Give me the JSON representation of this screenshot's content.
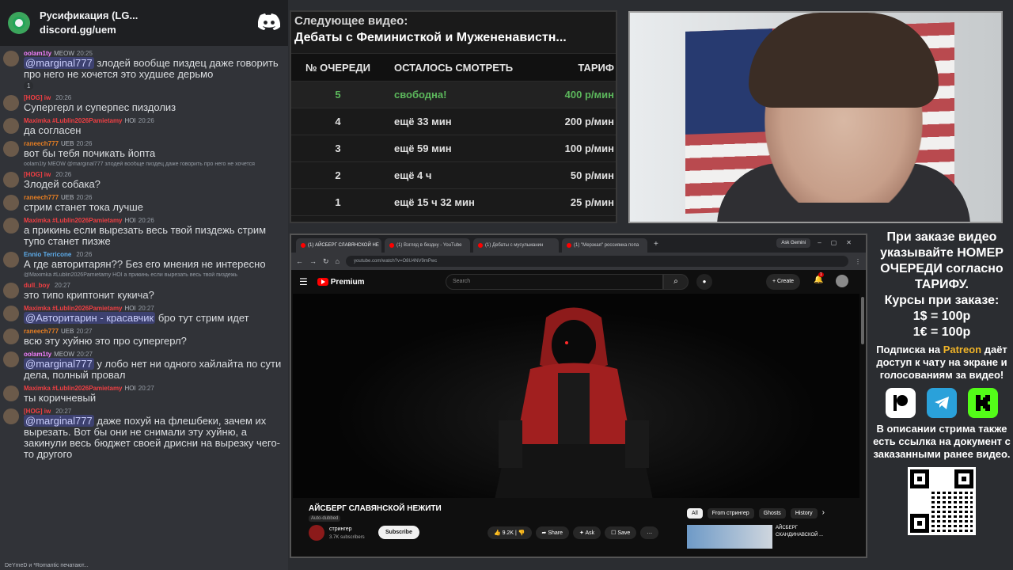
{
  "discord": {
    "server_name": "Русификация (LG...",
    "server_link": "discord.gg/uem",
    "typing_text": "DeYmeD и *Romantic печатают..."
  },
  "messages": [
    {
      "name": "oolam1ty",
      "name_color": "#f47fff",
      "tag": "MEOW",
      "time": "20:25",
      "mention": "@marginal777",
      "text": " злодей вообще пиздец даже говорить про него не хочется это худшее дерьмо",
      "reactions": [
        "1"
      ]
    },
    {
      "name": "[HOG] iw",
      "name_color": "#f23f43",
      "tag": "",
      "time": "20:26",
      "mention": "",
      "text": "Супергерл и суперпес пиздолиз"
    },
    {
      "name": "Maximka #Lublin2026Pamietamy",
      "name_color": "#f23f43",
      "tag": "HOI",
      "time": "20:26",
      "mention": "",
      "text": "да согласен"
    },
    {
      "name": "raneech777",
      "name_color": "#e67e22",
      "tag": "UEB",
      "time": "20:26",
      "mention": "",
      "text": "вот бы тебя почикать йопта"
    },
    {
      "reply": "oolam1ty MEOW @marginal777 злодей вообще пиздец даже говорить про него не хочется",
      "name": "[HOG] iw",
      "name_color": "#f23f43",
      "tag": "",
      "time": "20:26",
      "mention": "",
      "text": "Злодей собака?"
    },
    {
      "name": "raneech777",
      "name_color": "#e67e22",
      "tag": "UEB",
      "time": "20:26",
      "mention": "",
      "text": "стрим станет тока лучше"
    },
    {
      "name": "Maximka #Lublin2026Pamietamy",
      "name_color": "#f23f43",
      "tag": "HOI",
      "time": "20:26",
      "mention": "",
      "text": "а прикинь если вырезать весь твой пиздежь стрим тупо станет пизже"
    },
    {
      "name": "Ennio Terricone",
      "name_color": "#5dadec",
      "tag": "",
      "time": "20:26",
      "mention": "",
      "text": "А где авторитарян?? Без его мнения не интересно"
    },
    {
      "reply": "@Maximka #Lublin2026Pamietamy HOI а прикинь если вырезать весь твой пиздежь",
      "name": "dull_boy",
      "name_color": "#f23f43",
      "tag": "",
      "time": "20:27",
      "mention": "",
      "text": "это типо криптонит кукича?"
    },
    {
      "name": "Maximka #Lublin2026Pamietamy",
      "name_color": "#f23f43",
      "tag": "HOI",
      "time": "20:27",
      "mention": "@Авторитарин - красавчик",
      "text": " бро тут стрим идет"
    },
    {
      "name": "raneech777",
      "name_color": "#e67e22",
      "tag": "UEB",
      "time": "20:27",
      "mention": "",
      "text": "всю эту хуйню это про супергерл?"
    },
    {
      "name": "oolam1ty",
      "name_color": "#f47fff",
      "tag": "MEOW",
      "time": "20:27",
      "mention": "@marginal777",
      "text": " у лобо нет ни одного хайлайта по сути дела, полный провал"
    },
    {
      "name": "Maximka #Lublin2026Pamietamy",
      "name_color": "#f23f43",
      "tag": "HOI",
      "time": "20:27",
      "mention": "",
      "text": "ты коричневый"
    },
    {
      "name": "[HOG] iw",
      "name_color": "#f23f43",
      "tag": "",
      "time": "20:27",
      "mention": "@marginal777",
      "text": " даже похуй на флешбеки, зачем их вырезать. Вот бы они не снимали эту хуйню, а закинули весь бюджет своей дрисни на вырезку чего-то другого"
    }
  ],
  "queue": {
    "next_label": "Следующее видео:",
    "next_title": "Дебаты с Феминисткой и Мужененавистн...",
    "headers": [
      "№ ОЧЕРЕДИ",
      "ОСТАЛОСЬ СМОТРЕТЬ",
      "ТАРИФ"
    ],
    "rows": [
      {
        "num": "5",
        "left": "свободна!",
        "price": "400 р/мин",
        "free": true
      },
      {
        "num": "4",
        "left": "ещё 33 мин",
        "price": "200 р/мин",
        "free": false
      },
      {
        "num": "3",
        "left": "ещё 59 мин",
        "price": "100 р/мин",
        "free": false
      },
      {
        "num": "2",
        "left": "ещё 4 ч",
        "price": "50 р/мин",
        "free": false
      },
      {
        "num": "1",
        "left": "ещё 15 ч 32 мин",
        "price": "25 р/мин",
        "free": false
      }
    ]
  },
  "browser": {
    "tabs": [
      "(1) АЙСБЕРГ СЛАВЯНСКОЙ НЕ",
      "(1) Взгляд в бездну - YouTube",
      "(1) Дебаты с мусульманин",
      "(1) \"Мерзкая\" россиянка попа"
    ],
    "ask_gemini": "Ask Gemini",
    "url": "youtube.com/watch?v=O8U4NV9mPwc",
    "yt_brand": "Premium",
    "search_placeholder": "Search",
    "create_label": "Create",
    "notif_count": "1",
    "video_title": "АЙСБЕРГ СЛАВЯНСКОЙ НЕЖИТИ",
    "dubbed": "Auto-dubbed",
    "channel": "стрингер",
    "subs": "3.7K subscribers",
    "subscribe": "Subscribe",
    "likes": "9.2K",
    "share": "Share",
    "ask": "Ask",
    "save": "Save",
    "chips": [
      "All",
      "From стрингер",
      "Ghosts",
      "History"
    ],
    "rec_title": "АЙСБЕРГ СКАНДИНАВСКОЙ ..."
  },
  "info": {
    "line1": "При заказе видео указывайте НОМЕР ОЧЕРЕДИ согласно ТАРИФУ.",
    "line2": "Курсы при заказе:",
    "rate1": "1$ = 100р",
    "rate2": "1€ = 100р",
    "sub_pre": "Подписка на ",
    "patreon": "Patreon",
    "sub_post": " даёт доступ к чату на экране и голосованиям за видео!",
    "desc": "В описании стрима также есть ссылка на документ с заказанными ранее видео."
  }
}
